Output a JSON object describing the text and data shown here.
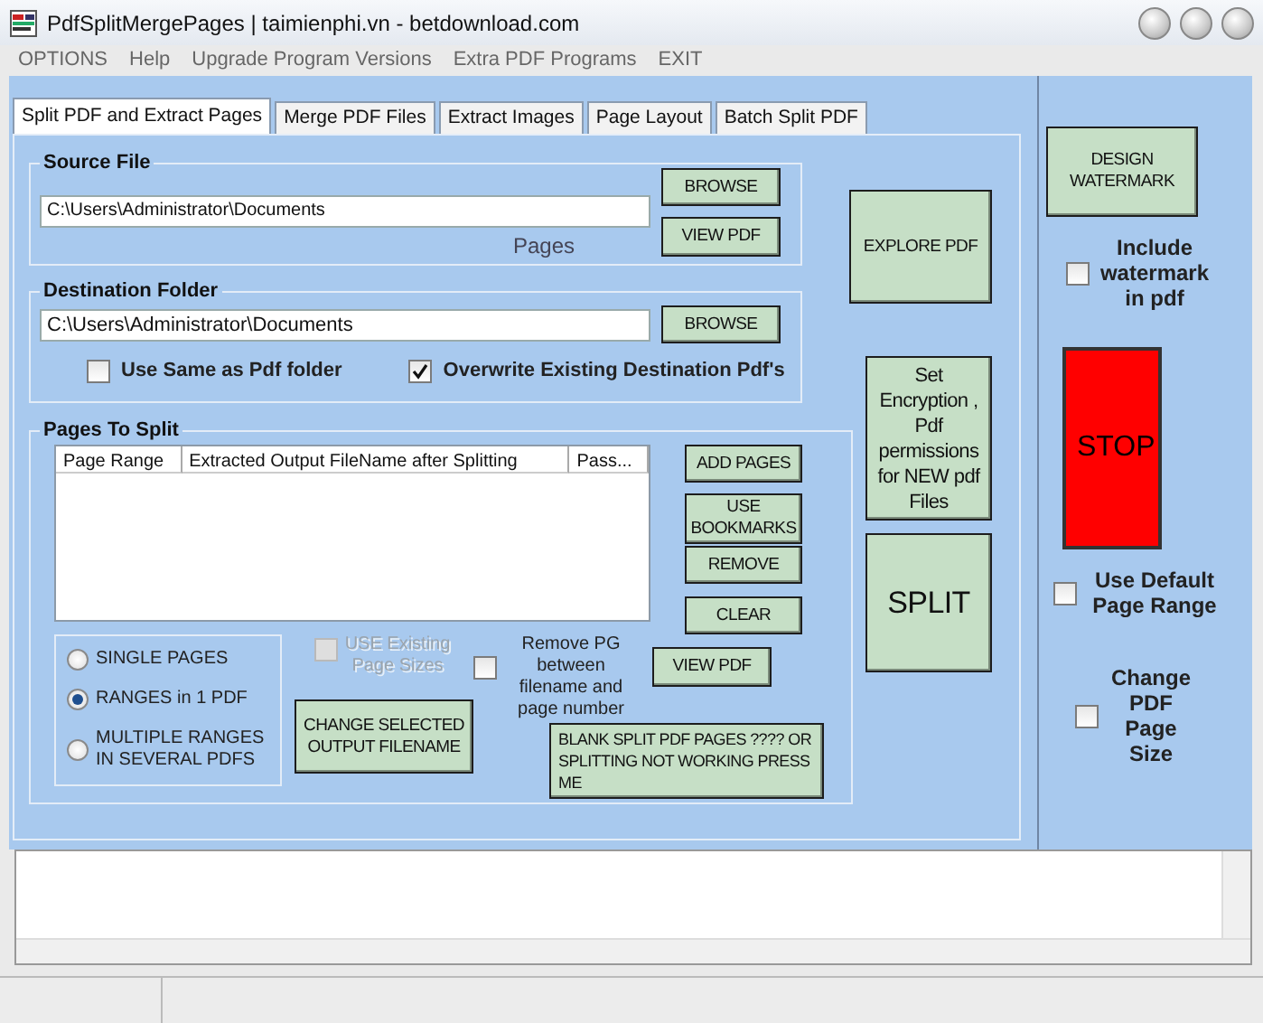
{
  "window": {
    "title": "PdfSplitMergePages | taimienphi.vn - betdownload.com"
  },
  "menu": [
    "OPTIONS",
    "Help",
    "Upgrade Program Versions",
    "Extra PDF Programs",
    "EXIT"
  ],
  "tabs": [
    {
      "label": "Split PDF and Extract Pages",
      "selected": true
    },
    {
      "label": "Merge PDF Files",
      "selected": false
    },
    {
      "label": "Extract Images",
      "selected": false
    },
    {
      "label": "Page Layout",
      "selected": false
    },
    {
      "label": "Batch Split PDF",
      "selected": false
    }
  ],
  "source_file": {
    "title": "Source File",
    "path": "C:\\Users\\Administrator\\Documents",
    "pages_label": "Pages",
    "buttons": [
      "BROWSE",
      "VIEW PDF"
    ]
  },
  "destination_folder": {
    "title": "Destination Folder",
    "path": "C:\\Users\\Administrator\\Documents",
    "button": "BROWSE",
    "options": [
      {
        "label": "Use Same as Pdf folder",
        "checked": false
      },
      {
        "label": "Overwrite Existing Destination Pdf's",
        "checked": true
      }
    ]
  },
  "explore_button": "EXPLORE PDF",
  "pages_to_split": {
    "title": "Pages To Split",
    "columns": [
      "Page Range",
      "Extracted Output FileName after Splitting",
      "Pass..."
    ],
    "buttons": [
      "ADD PAGES",
      "USE BOOKMARKS",
      "REMOVE",
      "CLEAR"
    ],
    "modes": [
      {
        "label": "SINGLE PAGES",
        "selected": false
      },
      {
        "label": "RANGES in 1 PDF",
        "selected": true
      },
      {
        "label": "MULTIPLE RANGES IN SEVERAL PDFS",
        "selected": false
      }
    ],
    "use_existing_sizes": {
      "label": "USE Existing Page Sizes",
      "checked": false,
      "disabled": true
    },
    "remove_pg": {
      "label": "Remove PG between filename and page number",
      "checked": false
    },
    "view_pdf_button": "VIEW PDF",
    "change_filename_button": "CHANGE SELECTED OUTPUT FILENAME",
    "help_button": "BLANK SPLIT PDF PAGES ???? OR SPLITTING NOT WORKING PRESS ME"
  },
  "encryption_button": "Set Encryption , Pdf permissions for NEW pdf Files",
  "split_button": "SPLIT",
  "watermark": {
    "button": "DESIGN WATERMARK",
    "include": {
      "label": "Include watermark in pdf",
      "checked": false
    }
  },
  "stop_button": "STOP",
  "options": [
    {
      "label": "Use Default Page Range",
      "checked": false
    },
    {
      "label": "Change PDF Page Size",
      "checked": false
    }
  ]
}
